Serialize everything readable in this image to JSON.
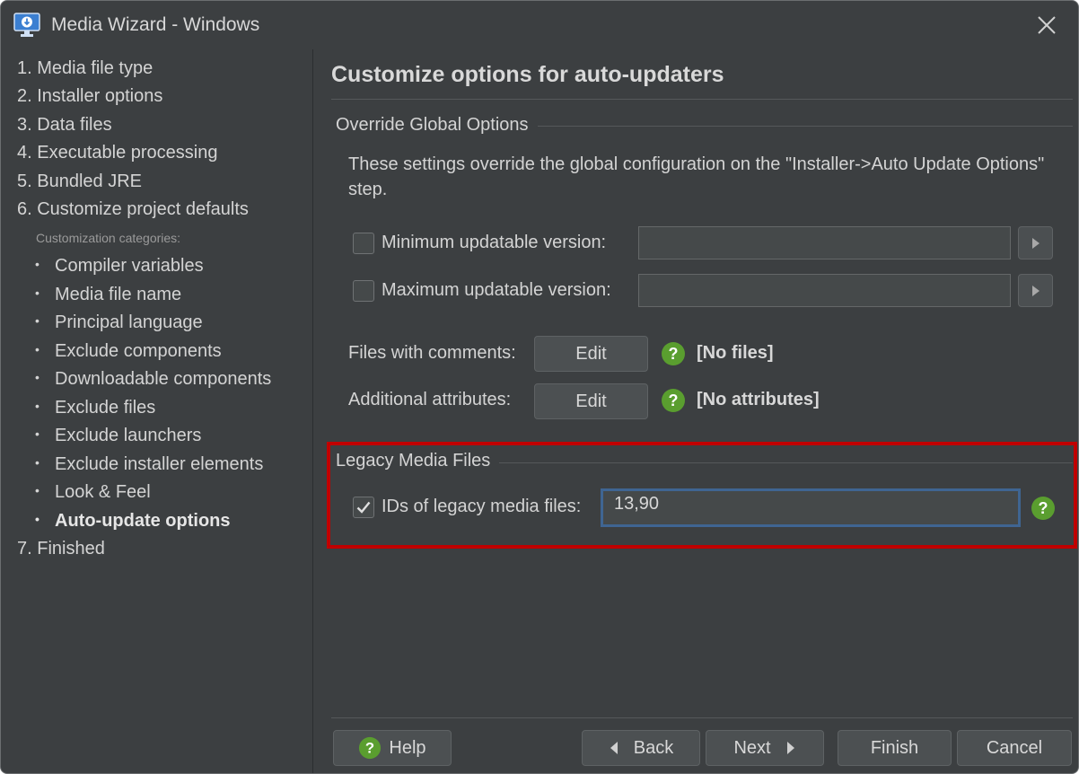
{
  "window": {
    "title": "Media Wizard - Windows"
  },
  "icons": {
    "app": "monitor-download-icon",
    "close": "close-icon",
    "help": "question-mark-icon",
    "arrow_left": "triangle-left-icon",
    "arrow_right": "triangle-right-icon",
    "checkmark": "checkmark-icon"
  },
  "sidebar": {
    "steps": [
      "1. Media file type",
      "2. Installer options",
      "3. Data files",
      "4. Executable processing",
      "5. Bundled JRE",
      "6. Customize project defaults"
    ],
    "categories_label": "Customization categories:",
    "categories": [
      "Compiler variables",
      "Media file name",
      "Principal language",
      "Exclude components",
      "Downloadable components",
      "Exclude files",
      "Exclude launchers",
      "Exclude installer elements",
      "Look & Feel",
      "Auto-update options"
    ],
    "active_category": "Auto-update options",
    "last_step": "7. Finished"
  },
  "main": {
    "heading": "Customize options for auto-updaters",
    "override_group": {
      "title": "Override Global Options",
      "description": "These settings override the global configuration on the \"Installer->Auto Update Options\" step.",
      "min_version": {
        "label": "Minimum updatable version:",
        "checked": false,
        "value": ""
      },
      "max_version": {
        "label": "Maximum updatable version:",
        "checked": false,
        "value": ""
      },
      "files_with_comments": {
        "label": "Files with comments:",
        "button": "Edit",
        "value": "[No files]"
      },
      "additional_attributes": {
        "label": "Additional attributes:",
        "button": "Edit",
        "value": "[No attributes]"
      }
    },
    "legacy_group": {
      "title": "Legacy Media Files",
      "ids": {
        "label": "IDs of legacy media files:",
        "checked": true,
        "value": "13,90"
      }
    }
  },
  "footer": {
    "help": "Help",
    "back": "Back",
    "next": "Next",
    "finish": "Finish",
    "cancel": "Cancel"
  },
  "colors": {
    "background": "#3c3f41",
    "help_green": "#5a9e2f",
    "focus_border": "#3f6592",
    "highlight_red": "#c00000"
  }
}
